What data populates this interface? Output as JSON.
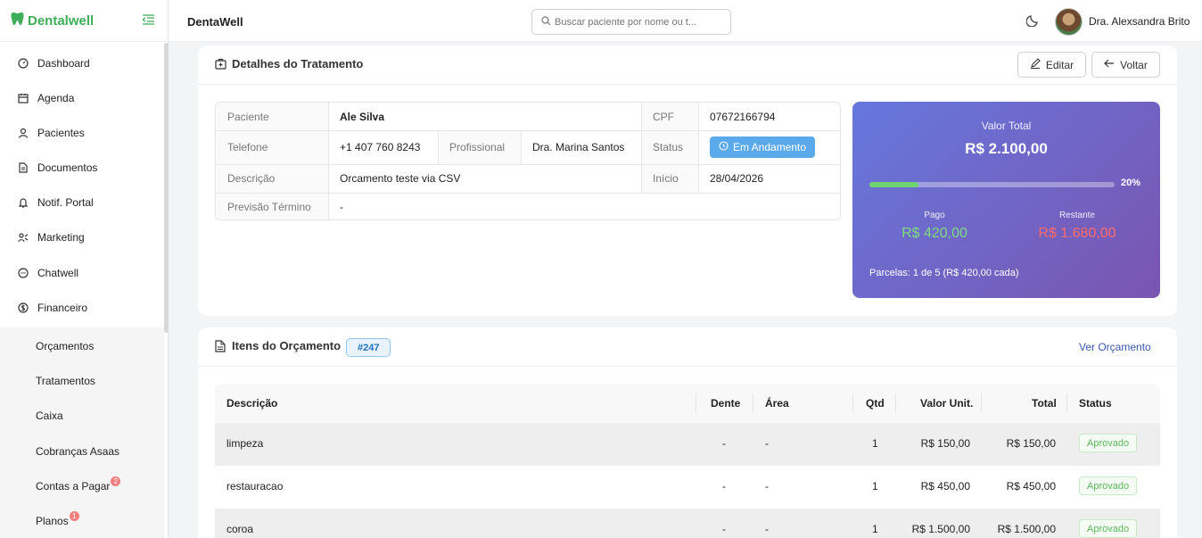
{
  "sidebar": {
    "brand": "Dentalwell",
    "items": [
      {
        "label": "Dashboard",
        "icon": "dashboard-icon"
      },
      {
        "label": "Agenda",
        "icon": "calendar-icon"
      },
      {
        "label": "Pacientes",
        "icon": "user-icon"
      },
      {
        "label": "Documentos",
        "icon": "document-icon"
      },
      {
        "label": "Notif. Portal",
        "icon": "bell-icon"
      },
      {
        "label": "Marketing",
        "icon": "marketing-icon"
      },
      {
        "label": "Chatwell",
        "icon": "chat-icon"
      },
      {
        "label": "Financeiro",
        "icon": "dollar-icon"
      }
    ],
    "submenu": [
      {
        "label": "Orçamentos",
        "badge": ""
      },
      {
        "label": "Tratamentos",
        "badge": ""
      },
      {
        "label": "Caixa",
        "badge": ""
      },
      {
        "label": "Cobranças Asaas",
        "badge": ""
      },
      {
        "label": "Contas a Pagar",
        "badge": "2"
      },
      {
        "label": "Planos",
        "badge": "1"
      }
    ]
  },
  "topbar": {
    "title": "DentaWell",
    "search_placeholder": "Buscar paciente por nome ou t...",
    "user_name": "Dra. Alexsandra Brito"
  },
  "details_card": {
    "title": "Detalhes do Tratamento",
    "edit_label": "Editar",
    "back_label": "Voltar",
    "fields": {
      "paciente_label": "Paciente",
      "paciente": "Ale Silva",
      "cpf_label": "CPF",
      "cpf": "07672166794",
      "telefone_label": "Telefone",
      "telefone": "+1 407 760 8243",
      "profissional_label": "Profissional",
      "profissional": "Dra. Marina Santos",
      "status_label": "Status",
      "status": "Em Andamento",
      "descricao_label": "Descrição",
      "descricao": "Orcamento teste via CSV",
      "inicio_label": "Início",
      "inicio": "28/04/2026",
      "previsao_label": "Previsão Término",
      "previsao": "-"
    },
    "summary": {
      "total_label": "Valor Total",
      "total": "R$ 2.100,00",
      "progress_percent": 20,
      "progress_text": "20%",
      "pago_label": "Pago",
      "pago": "R$ 420,00",
      "restante_label": "Restante",
      "restante": "R$ 1.680,00",
      "parcelas": "Parcelas: 1 de 5 (R$ 420,00 cada)"
    }
  },
  "items_card": {
    "title": "Itens do Orçamento",
    "tag": "#247",
    "link": "Ver Orçamento",
    "columns": [
      "Descrição",
      "Dente",
      "Área",
      "Qtd",
      "Valor Unit.",
      "Total",
      "Status"
    ],
    "rows": [
      {
        "descricao": "limpeza",
        "dente": "-",
        "area": "-",
        "qtd": "1",
        "valor_unit": "R$ 150,00",
        "total": "R$ 150,00",
        "status": "Aprovado"
      },
      {
        "descricao": "restauracao",
        "dente": "-",
        "area": "-",
        "qtd": "1",
        "valor_unit": "R$ 450,00",
        "total": "R$ 450,00",
        "status": "Aprovado"
      },
      {
        "descricao": "coroa",
        "dente": "-",
        "area": "-",
        "qtd": "1",
        "valor_unit": "R$ 1.500,00",
        "total": "R$ 1.500,00",
        "status": "Aprovado"
      }
    ]
  },
  "colors": {
    "brand_green": "#3fae5a",
    "pago_green": "#7ddc7d",
    "restante_red": "#ff6b6b",
    "status_blue": "#5aa9ea",
    "link_blue": "#3a56b0"
  }
}
